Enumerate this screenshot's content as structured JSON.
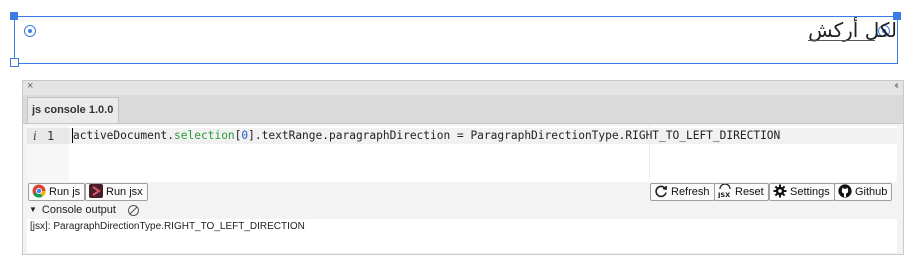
{
  "canvas": {
    "frame_text": "لكل أركش"
  },
  "panel": {
    "close_glyph": "×",
    "collapse_glyph": "‹‹",
    "tab_label": "js console 1.0.0",
    "editor": {
      "gutter_marker": "i",
      "line_number": "1",
      "code_parts": [
        "activeDocument.",
        "selection",
        "[",
        "0",
        "].textRange.paragraphDirection = ParagraphDirectionType.RIGHT_TO_LEFT_DIRECTION"
      ]
    },
    "buttons": {
      "run_js": "Run js",
      "run_jsx": "Run jsx",
      "refresh": "Refresh",
      "reset": "Reset",
      "settings": "Settings",
      "github": "Github"
    },
    "console_label": "Console output",
    "output_text": "[jsx]: ParagraphDirectionType.RIGHT_TO_LEFT_DIRECTION"
  },
  "colors": {
    "selection_blue": "#3b7be6",
    "code_green": "#2d9a3c",
    "code_number_blue": "#1f5bcf"
  },
  "icons": [
    "chrome-icon",
    "extendscript-icon",
    "refresh-icon",
    "jsx-icon",
    "gear-icon",
    "github-icon",
    "clear-console-icon"
  ]
}
